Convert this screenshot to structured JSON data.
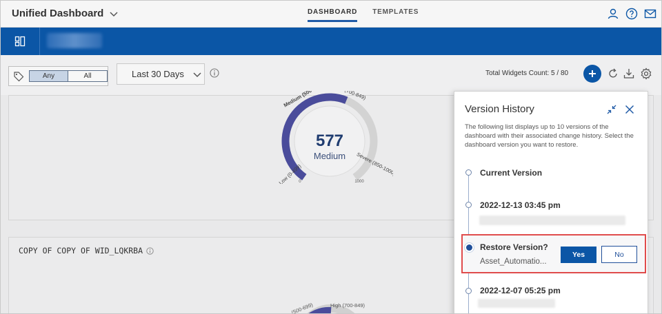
{
  "app": {
    "title": "Unified Dashboard",
    "tabs": [
      {
        "label": "DASHBOARD",
        "active": true
      },
      {
        "label": "TEMPLATES",
        "active": false
      }
    ],
    "icons": [
      "user-icon",
      "help-icon",
      "mail-icon"
    ]
  },
  "toolbar": {
    "tag_filter": {
      "options": [
        "Any",
        "All"
      ],
      "selected": "Any"
    },
    "date_range": "Last 30 Days",
    "widget_count": "Total Widgets Count: 5 / 80"
  },
  "gauge": {
    "value": "577",
    "rating": "Medium",
    "bands": [
      "Low (0-499)",
      "Medium (500-699)",
      "High (700-849)",
      "Severe (850-1000)"
    ],
    "min_label": "0",
    "max_label": "1000",
    "level_fraction": 0.577,
    "colors": {
      "fill": "#4a4c9b",
      "track": "#d3d3d3"
    }
  },
  "widget2": {
    "title": "COPY OF COPY OF WID_LQKRBA",
    "gauge_bands": [
      "(500-699)",
      "High (700-849)"
    ]
  },
  "version_history": {
    "title": "Version History",
    "description": "The following list displays up to 10 versions of the dashboard with their associated change history. Select the dashboard version you want to restore.",
    "versions": [
      {
        "label": "Current Version"
      },
      {
        "label": "2022-12-13 03:45 pm"
      },
      {
        "label": "2022-12-07 05:25 pm"
      }
    ],
    "restore": {
      "question": "Restore Version?",
      "name": "Asset_Automatio...",
      "yes_label": "Yes",
      "no_label": "No",
      "highlight_color": "#e04b4b"
    }
  },
  "colors": {
    "brand": "#0b56a6",
    "accent": "#1f5aa6"
  }
}
